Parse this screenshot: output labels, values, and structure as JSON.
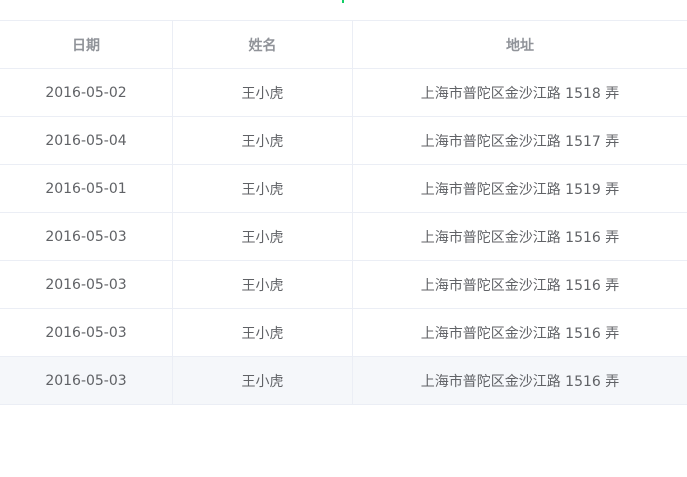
{
  "table": {
    "columns": [
      "日期",
      "姓名",
      "地址"
    ],
    "rows": [
      {
        "date": "2016-05-02",
        "name": "王小虎",
        "address": "上海市普陀区金沙江路 1518 弄"
      },
      {
        "date": "2016-05-04",
        "name": "王小虎",
        "address": "上海市普陀区金沙江路 1517 弄"
      },
      {
        "date": "2016-05-01",
        "name": "王小虎",
        "address": "上海市普陀区金沙江路 1519 弄"
      },
      {
        "date": "2016-05-03",
        "name": "王小虎",
        "address": "上海市普陀区金沙江路 1516 弄"
      },
      {
        "date": "2016-05-03",
        "name": "王小虎",
        "address": "上海市普陀区金沙江路 1516 弄"
      },
      {
        "date": "2016-05-03",
        "name": "王小虎",
        "address": "上海市普陀区金沙江路 1516 弄"
      },
      {
        "date": "2016-05-03",
        "name": "王小虎",
        "address": "上海市普陀区金沙江路 1516 弄"
      }
    ]
  },
  "colors": {
    "border": "#ebeef5",
    "header_text": "#909399",
    "cell_text": "#606266",
    "hover_row": "#f5f7fa",
    "accent": "#13ce66"
  }
}
